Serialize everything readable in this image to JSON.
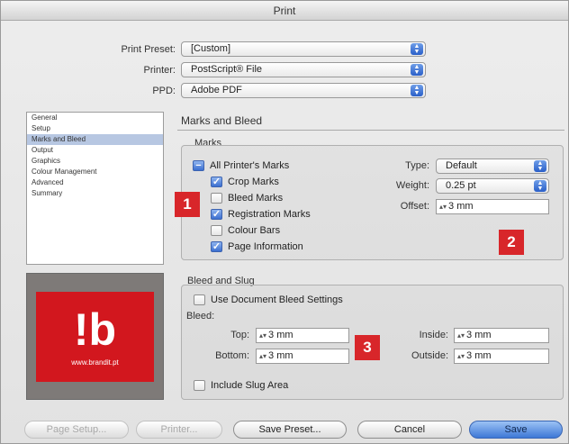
{
  "window": {
    "title": "Print"
  },
  "top": {
    "preset_label": "Print Preset:",
    "preset_value": "[Custom]",
    "printer_label": "Printer:",
    "printer_value": "PostScript® File",
    "ppd_label": "PPD:",
    "ppd_value": "Adobe PDF"
  },
  "sidebar": {
    "items": [
      {
        "label": "General"
      },
      {
        "label": "Setup"
      },
      {
        "label": "Marks and Bleed",
        "selected": true
      },
      {
        "label": "Output"
      },
      {
        "label": "Graphics"
      },
      {
        "label": "Colour Management"
      },
      {
        "label": "Advanced"
      },
      {
        "label": "Summary"
      }
    ]
  },
  "logo": {
    "mark": "!b",
    "url": "www.brandit.pt"
  },
  "section": {
    "title": "Marks and Bleed"
  },
  "marks": {
    "group_label": "Marks",
    "all": "All Printer's Marks",
    "crop": "Crop Marks",
    "bleed": "Bleed Marks",
    "registration": "Registration Marks",
    "colour_bars": "Colour Bars",
    "page_info": "Page Information",
    "type_label": "Type:",
    "type_value": "Default",
    "weight_label": "Weight:",
    "weight_value": "0.25 pt",
    "offset_label": "Offset:",
    "offset_value": "3 mm"
  },
  "bleed": {
    "group_label": "Bleed and Slug",
    "use_doc": "Use Document Bleed Settings",
    "bleed_label": "Bleed:",
    "top_label": "Top:",
    "top_value": "3 mm",
    "bottom_label": "Bottom:",
    "bottom_value": "3 mm",
    "inside_label": "Inside:",
    "inside_value": "3 mm",
    "outside_label": "Outside:",
    "outside_value": "3 mm",
    "slug": "Include Slug Area"
  },
  "badges": {
    "b1": "1",
    "b2": "2",
    "b3": "3"
  },
  "buttons": {
    "page_setup": "Page Setup...",
    "printer": "Printer...",
    "save_preset": "Save Preset...",
    "cancel": "Cancel",
    "save": "Save"
  },
  "colors": {
    "badge": "#d8262a",
    "logo_red": "#d2171e",
    "selection": "#b7c7e2",
    "default_button": "#3d78d6"
  },
  "icons": {
    "popup": "popup-arrows-icon",
    "check": "checkmark-icon",
    "stepper": "stepper-arrows-icon"
  }
}
